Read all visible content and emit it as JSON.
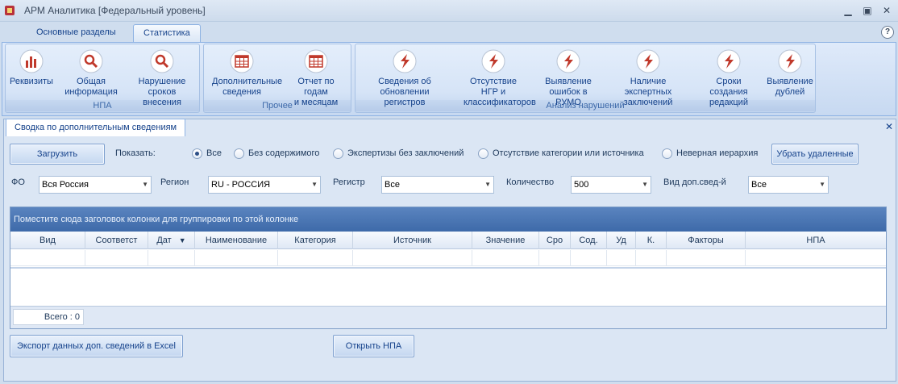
{
  "window": {
    "title": "АРМ Аналитика [Федеральный уровень]"
  },
  "ribbon": {
    "tabs": [
      "Основные разделы",
      "Статистика"
    ],
    "groups": [
      {
        "label": "НПА",
        "buttons": [
          {
            "label": "Реквизиты",
            "icon": "bar-chart-icon"
          },
          {
            "label": "Общая\nинформация",
            "icon": "magnifier-icon"
          },
          {
            "label": "Нарушение\nсроков внесения",
            "icon": "magnifier-icon"
          }
        ]
      },
      {
        "label": "Прочее",
        "buttons": [
          {
            "label": "Дополнительные\nсведения",
            "icon": "table-icon"
          },
          {
            "label": "Отчет по годам\nи месяцам",
            "icon": "table-icon"
          }
        ]
      },
      {
        "label": "Анализ нарушений",
        "buttons": [
          {
            "label": "Сведения об\nобновлении регистров",
            "icon": "lightning-icon"
          },
          {
            "label": "Отсутствие НГР и\nклассификаторов",
            "icon": "lightning-icon"
          },
          {
            "label": "Выявление\nошибок в РУМО",
            "icon": "lightning-icon"
          },
          {
            "label": "Наличие экспертных\nзаключений",
            "icon": "lightning-icon"
          },
          {
            "label": "Сроки создания\nредакций",
            "icon": "lightning-icon"
          },
          {
            "label": "Выявление\nдублей",
            "icon": "lightning-icon"
          }
        ]
      }
    ]
  },
  "document": {
    "tab_label": "Сводка по дополнительным сведениям",
    "load_button": "Загрузить",
    "show_label": "Показать:",
    "radio_options": [
      "Все",
      "Без содержимого",
      "Экспертизы без заключений",
      "Отсутствие категории или источника",
      "Неверная иерархия"
    ],
    "radio_selected": "Все",
    "remove_deleted_button": "Убрать удаленные",
    "filters": {
      "fo_label": "ФО",
      "fo_value": "Вся Россия",
      "region_label": "Регион",
      "region_value": "RU - РОССИЯ",
      "register_label": "Регистр",
      "register_value": "Все",
      "count_label": "Количество",
      "count_value": "500",
      "extra_label": "Вид доп.свед-й",
      "extra_value": "Все"
    },
    "grid": {
      "group_hint": "Поместите сюда заголовок колонки для группировки по этой колонке",
      "columns": [
        "Вид",
        "Соответст",
        "Дат",
        "Наименование",
        "Категория",
        "Источник",
        "Значение",
        "Сро",
        "Сод.",
        "Уд",
        "К.",
        "Факторы",
        "НПА"
      ],
      "total": "Всего : 0"
    },
    "export_button": "Экспорт данных доп. сведений в Excel",
    "open_npa_button": "Открыть НПА"
  }
}
